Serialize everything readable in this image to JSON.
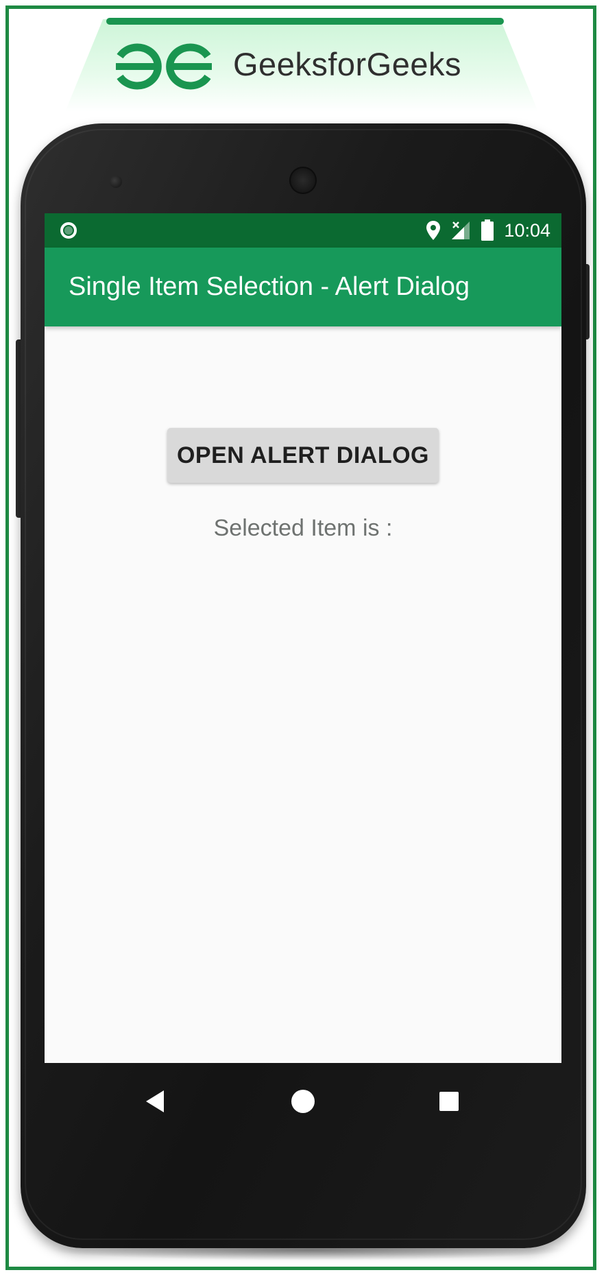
{
  "header": {
    "brand_name": "GeeksforGeeks",
    "logo_icon": "gfg-logo-icon",
    "brand_color": "#1a9550"
  },
  "status_bar": {
    "time": "10:04",
    "icons": [
      "location-icon",
      "signal-no-sim-icon",
      "battery-icon"
    ],
    "left_icon": "notification-dot-icon",
    "background": "#0b6a31"
  },
  "app_bar": {
    "title": "Single Item Selection - Alert Dialog",
    "background": "#17995a"
  },
  "main": {
    "open_button_label": "OPEN ALERT DIALOG",
    "selected_item_label": "Selected Item is :"
  },
  "nav_bar": {
    "buttons": [
      "back-icon",
      "home-icon",
      "recents-icon"
    ]
  }
}
